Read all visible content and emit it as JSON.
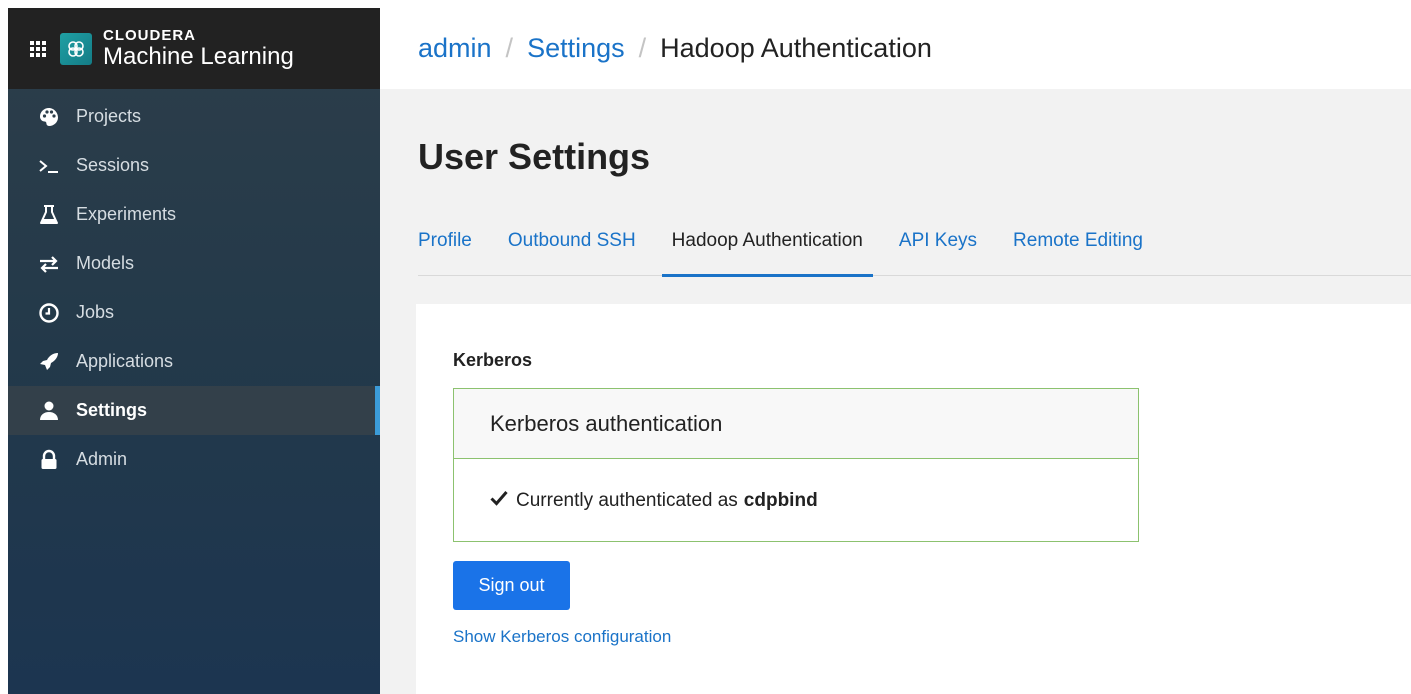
{
  "brand": {
    "company": "CLOUDERA",
    "product": "Machine Learning"
  },
  "sidebar": {
    "items": [
      {
        "label": "Projects",
        "icon": "palette-icon"
      },
      {
        "label": "Sessions",
        "icon": "terminal-icon"
      },
      {
        "label": "Experiments",
        "icon": "flask-icon"
      },
      {
        "label": "Models",
        "icon": "exchange-icon"
      },
      {
        "label": "Jobs",
        "icon": "clock-icon"
      },
      {
        "label": "Applications",
        "icon": "rocket-icon"
      },
      {
        "label": "Settings",
        "icon": "user-icon",
        "active": true
      },
      {
        "label": "Admin",
        "icon": "lock-icon"
      }
    ]
  },
  "breadcrumb": {
    "root": "admin",
    "middle": "Settings",
    "current": "Hadoop Authentication",
    "separator": "/"
  },
  "page": {
    "title": "User Settings"
  },
  "tabs": [
    {
      "label": "Profile"
    },
    {
      "label": "Outbound SSH"
    },
    {
      "label": "Hadoop Authentication",
      "active": true
    },
    {
      "label": "API Keys"
    },
    {
      "label": "Remote Editing"
    }
  ],
  "kerberos": {
    "section_label": "Kerberos",
    "box_title": "Kerberos authentication",
    "status_prefix": "Currently authenticated as",
    "username": "cdpbind",
    "sign_out": "Sign out",
    "show_config": "Show Kerberos configuration"
  },
  "colors": {
    "accent": "#1a73e8",
    "link": "#1a73c8",
    "success_border": "#8cc26f",
    "sidebar_active_bar": "#3b9bd8"
  }
}
